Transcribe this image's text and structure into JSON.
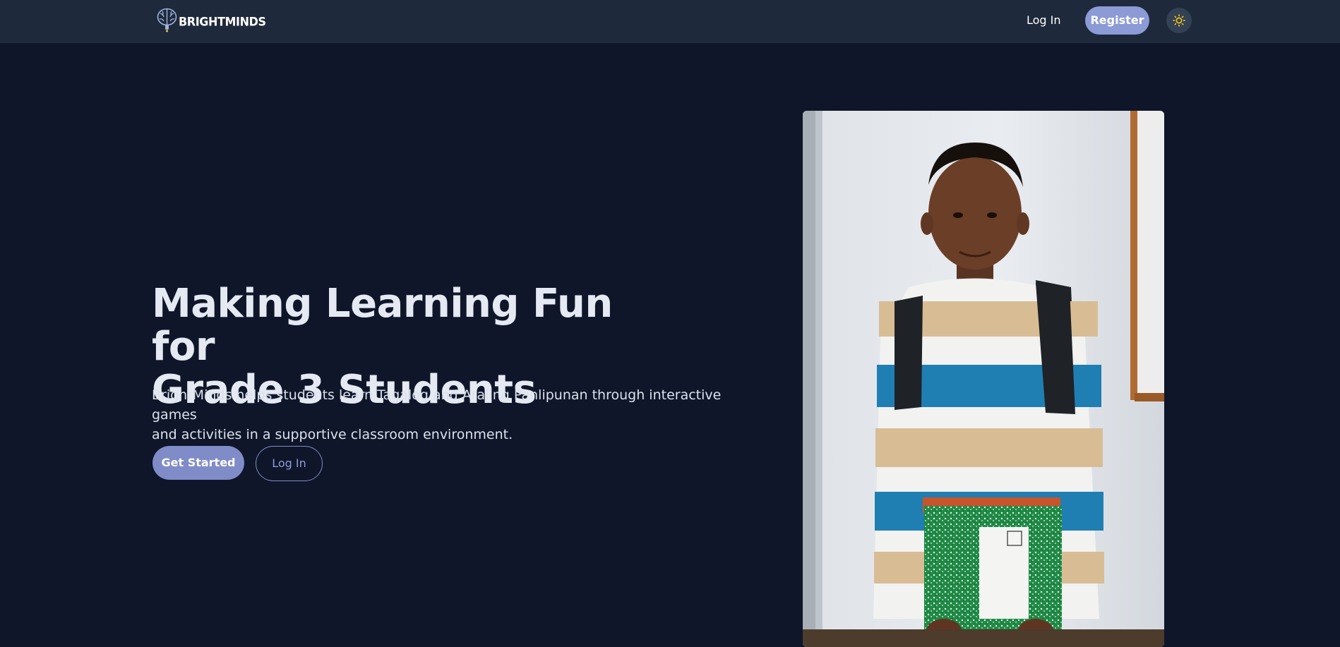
{
  "navbar": {
    "logo_text": "BRIGHTMINDS",
    "login_label": "Log In",
    "register_label": "Register",
    "theme_icon": "sun-icon"
  },
  "hero": {
    "title_line1": "Making Learning Fun for",
    "title_line2": "Grade 3 Students",
    "description_line1": "BrightMinds helps students learn Tagalog and Araling Panlipunan through interactive games",
    "description_line2": "and activities in a supportive classroom environment.",
    "get_started_label": "Get Started",
    "login_label": "Log In",
    "image_subject": "student-with-backpack-and-notebook"
  },
  "colors": {
    "background": "#0f1629",
    "navbar": "#1e293b",
    "accent": "#8c9ad6",
    "sun": "#facc15"
  }
}
